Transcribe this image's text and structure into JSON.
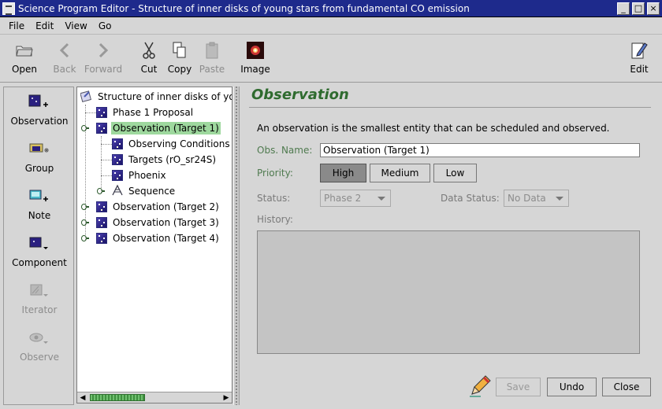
{
  "window": {
    "title": "Science Program Editor - Structure of inner disks of young stars from fundamental CO emission"
  },
  "menu": [
    "File",
    "Edit",
    "View",
    "Go"
  ],
  "toolbar": {
    "open": "Open",
    "back": "Back",
    "forward": "Forward",
    "cut": "Cut",
    "copy": "Copy",
    "paste": "Paste",
    "image": "Image",
    "edit": "Edit"
  },
  "palette": {
    "observation": "Observation",
    "group": "Group",
    "note": "Note",
    "component": "Component",
    "iterator": "Iterator",
    "observe": "Observe"
  },
  "tree": {
    "root": "Structure of inner disks of you",
    "items": [
      "Phase 1 Proposal",
      "Observation (Target 1)",
      "Observing Conditions",
      "Targets (rO_sr24S)",
      "Phoenix",
      "Sequence",
      "Observation (Target 2)",
      "Observation (Target 3)",
      "Observation (Target 4)"
    ]
  },
  "editor": {
    "title": "Observation",
    "description": "An observation is the smallest entity that can be scheduled and observed.",
    "obs_name_label": "Obs. Name:",
    "obs_name_value": "Observation (Target 1)",
    "priority_label": "Priority:",
    "priority_options": [
      "High",
      "Medium",
      "Low"
    ],
    "priority_selected": "High",
    "status_label": "Status:",
    "status_value": "Phase 2",
    "data_status_label": "Data Status:",
    "data_status_value": "No Data",
    "history_label": "History:"
  },
  "buttons": {
    "save": "Save",
    "undo": "Undo",
    "close": "Close"
  },
  "colors": {
    "titlebar": "#1e2a8c",
    "selection": "#9ed89e",
    "heading": "#2f6b2f"
  }
}
